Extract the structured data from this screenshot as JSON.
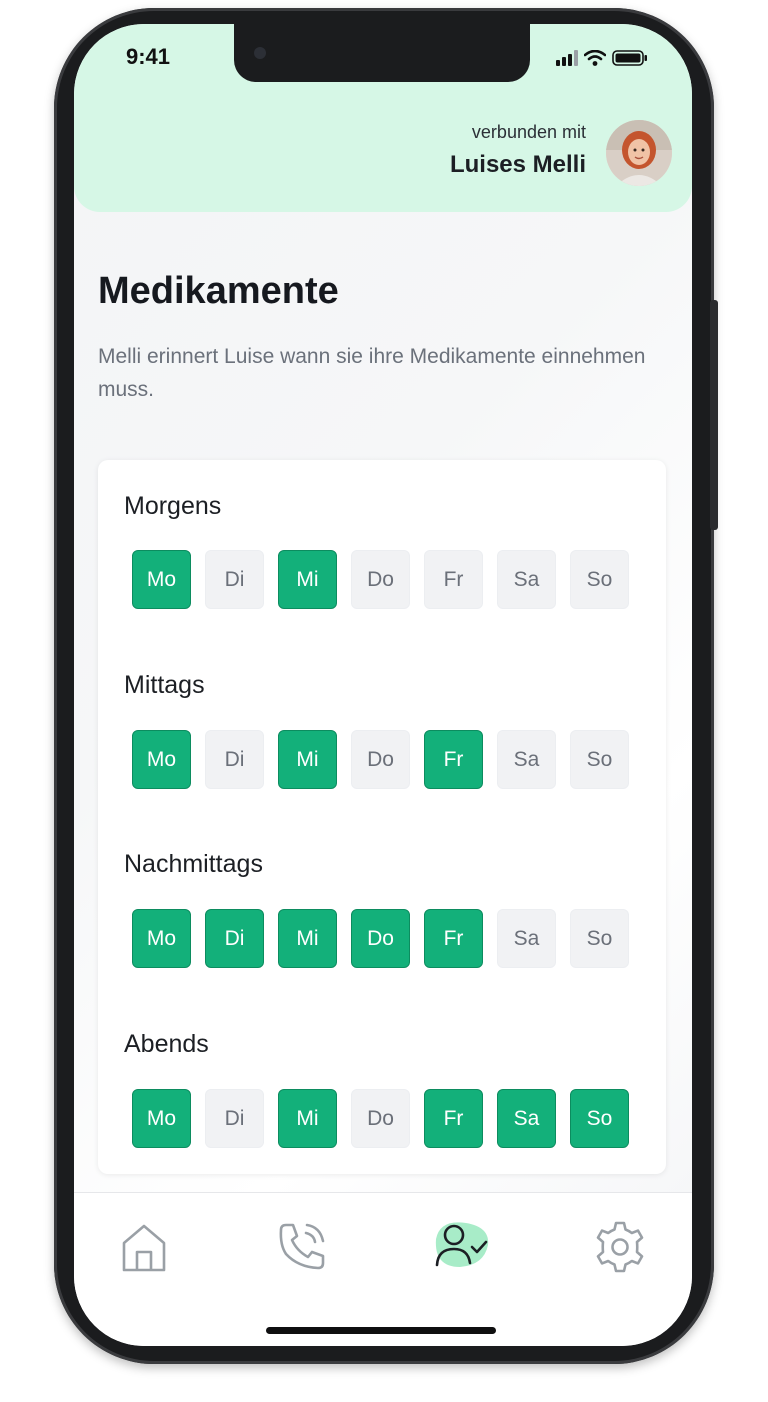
{
  "status_bar": {
    "time": "9:41"
  },
  "header": {
    "connected_label": "verbunden mit",
    "device_name": "Luises Melli"
  },
  "page": {
    "title": "Medikamente",
    "description": "Melli erinnert Luise wann sie ihre Medikamente einnehmen muss."
  },
  "schedule": [
    {
      "label": "Morgens",
      "days": [
        {
          "label": "Mo",
          "active": true
        },
        {
          "label": "Di",
          "active": false
        },
        {
          "label": "Mi",
          "active": true
        },
        {
          "label": "Do",
          "active": false
        },
        {
          "label": "Fr",
          "active": false
        },
        {
          "label": "Sa",
          "active": false
        },
        {
          "label": "So",
          "active": false
        }
      ]
    },
    {
      "label": "Mittags",
      "days": [
        {
          "label": "Mo",
          "active": true
        },
        {
          "label": "Di",
          "active": false
        },
        {
          "label": "Mi",
          "active": true
        },
        {
          "label": "Do",
          "active": false
        },
        {
          "label": "Fr",
          "active": true
        },
        {
          "label": "Sa",
          "active": false
        },
        {
          "label": "So",
          "active": false
        }
      ]
    },
    {
      "label": "Nachmittags",
      "days": [
        {
          "label": "Mo",
          "active": true
        },
        {
          "label": "Di",
          "active": true
        },
        {
          "label": "Mi",
          "active": true
        },
        {
          "label": "Do",
          "active": true
        },
        {
          "label": "Fr",
          "active": true
        },
        {
          "label": "Sa",
          "active": false
        },
        {
          "label": "So",
          "active": false
        }
      ]
    },
    {
      "label": "Abends",
      "days": [
        {
          "label": "Mo",
          "active": true
        },
        {
          "label": "Di",
          "active": false
        },
        {
          "label": "Mi",
          "active": true
        },
        {
          "label": "Do",
          "active": false
        },
        {
          "label": "Fr",
          "active": true
        },
        {
          "label": "Sa",
          "active": true
        },
        {
          "label": "So",
          "active": true
        }
      ]
    }
  ],
  "tabbar": {
    "items": [
      {
        "icon": "home-icon",
        "active": false
      },
      {
        "icon": "phone-call-icon",
        "active": false
      },
      {
        "icon": "user-check-icon",
        "active": true
      },
      {
        "icon": "gear-icon",
        "active": false
      }
    ]
  },
  "colors": {
    "accent": "#13b07a",
    "header_bg": "#d6f7e6",
    "inactive_day_bg": "#f1f2f4"
  }
}
